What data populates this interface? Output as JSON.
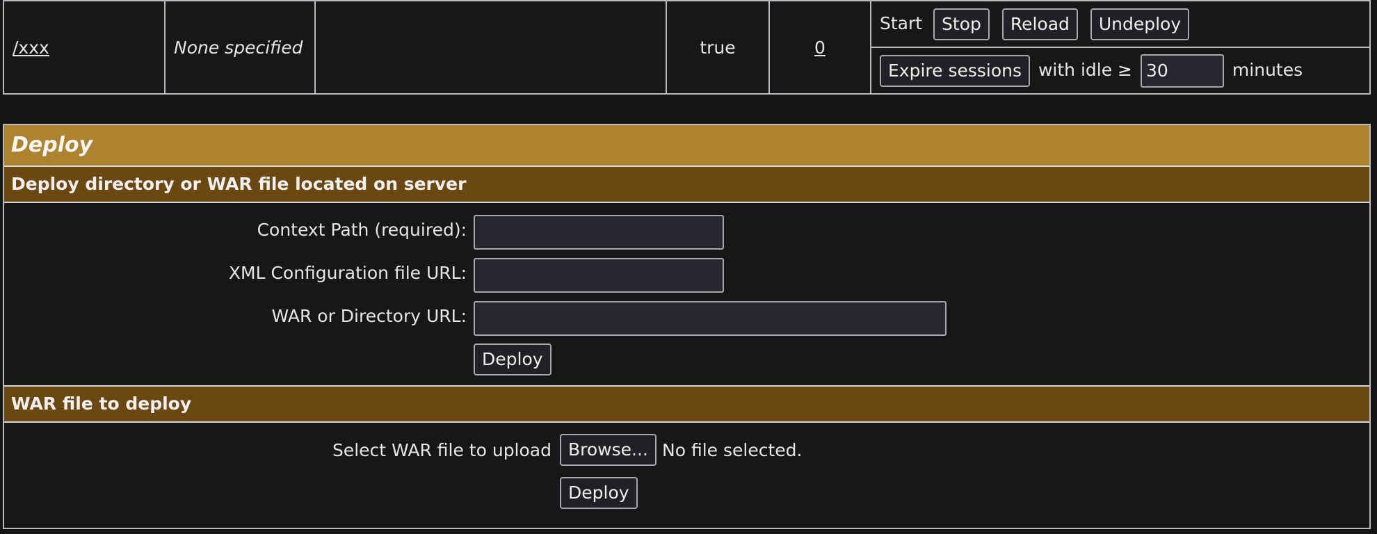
{
  "app_row": {
    "path": "/xxx",
    "version": "None specified",
    "display_name": "",
    "running": "true",
    "sessions": "0",
    "commands": {
      "start": "Start",
      "stop": "Stop",
      "reload": "Reload",
      "undeploy": "Undeploy",
      "expire": "Expire sessions",
      "with_idle": "with idle ≥",
      "idle_value": "30",
      "minutes": "minutes"
    }
  },
  "deploy": {
    "title": "Deploy",
    "server_section": {
      "title": "Deploy directory or WAR file located on server",
      "context_path_label": "Context Path (required):",
      "context_path_value": "",
      "xml_config_label": "XML Configuration file URL:",
      "xml_config_value": "",
      "war_dir_label": "WAR or Directory URL:",
      "war_dir_value": "",
      "deploy_button": "Deploy"
    },
    "upload_section": {
      "title": "WAR file to deploy",
      "select_label": "Select WAR file to upload",
      "browse_button": "Browse...",
      "file_status": "No file selected.",
      "deploy_button": "Deploy"
    }
  }
}
